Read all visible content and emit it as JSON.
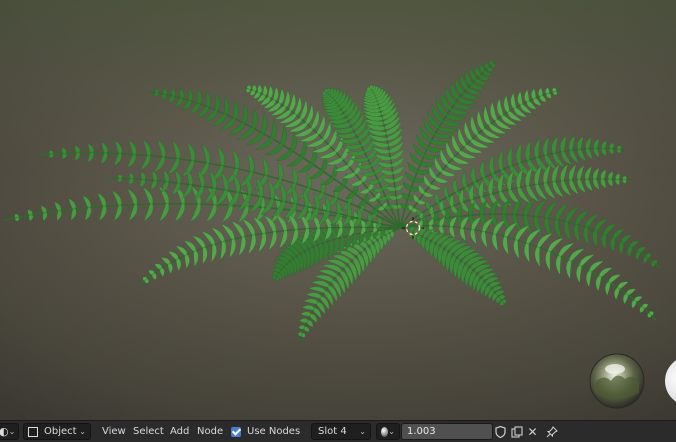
{
  "header": {
    "mode_select": {
      "value": "Object"
    },
    "menus": {
      "view": "View",
      "select": "Select",
      "add": "Add",
      "node": "Node"
    },
    "use_nodes": {
      "label": "Use Nodes",
      "checked": true
    },
    "slot_select": {
      "value": "Slot 4"
    },
    "value_field": {
      "value": "1.003"
    }
  },
  "colors": {
    "header_bg": "#2b2b2b",
    "checkbox_accent": "#4a7ecb",
    "fern_green": "#3f8a3a"
  },
  "icons": {
    "editor_type": "node-editor-icon",
    "object_mode": "object-mode-icon",
    "material_browse": "material-sphere-icon",
    "fake_user": "shield-icon",
    "duplicate": "copy-icon",
    "unlink": "close-icon",
    "pin": "pin-icon"
  }
}
